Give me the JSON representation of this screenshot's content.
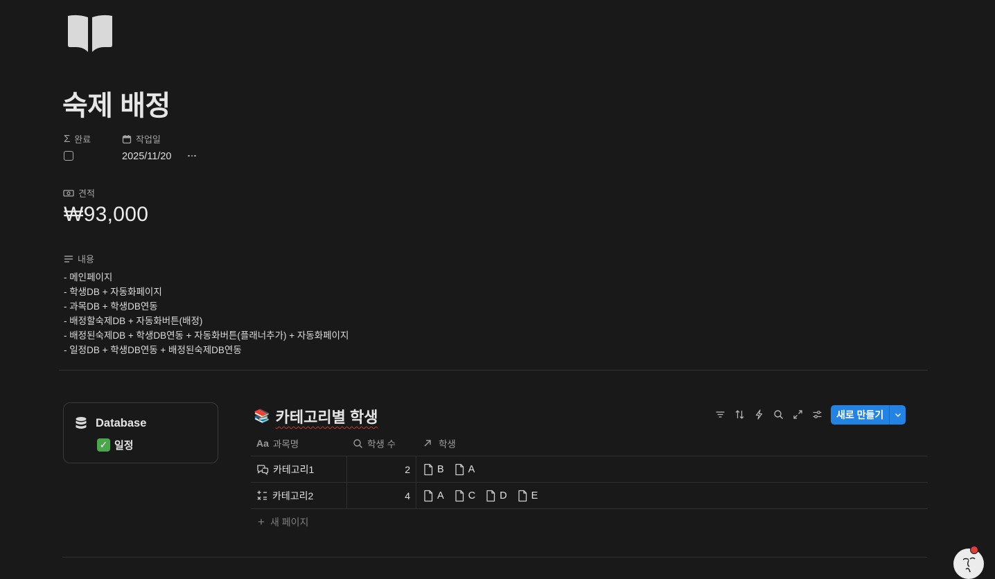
{
  "page": {
    "icon": "book-icon",
    "title": "숙제 배정"
  },
  "properties": {
    "done": {
      "label": "완료",
      "icon": "sigma-icon",
      "checked": false
    },
    "work_date": {
      "label": "작업일",
      "icon": "calendar-icon",
      "value": "2025/11/20"
    },
    "estimate": {
      "label": "견적",
      "icon": "banknote-icon",
      "value": "₩93,000"
    },
    "content": {
      "label": "내용",
      "icon": "text-lines-icon",
      "lines": [
        "- 메인페이지",
        "- 학생DB + 자동화페이지",
        "- 과목DB + 학생DB연동",
        "- 배정할숙제DB + 자동화버튼(배정)",
        "- 배정된숙제DB + 학생DB연동 + 자동화버튼(플래너추가) + 자동화페이지",
        "- 일정DB + 학생DB연동 + 배정된숙제DB연동"
      ]
    }
  },
  "db_card": {
    "title": "Database",
    "icon": "database-icon",
    "link": {
      "emoji": "✓",
      "label": "일정"
    }
  },
  "database": {
    "emoji": "📚",
    "title": "카테고리별 학생",
    "toolbar": {
      "icons": [
        "filter-icon",
        "sort-icon",
        "automation-icon",
        "search-icon",
        "expand-icon",
        "settings-icon"
      ],
      "new_label": "새로 만들기"
    },
    "columns": [
      {
        "label": "과목명",
        "icon": "title-aa-icon"
      },
      {
        "label": "학생 수",
        "icon": "search-icon"
      },
      {
        "label": "학생",
        "icon": "relation-arrow-icon"
      }
    ],
    "rows": [
      {
        "icon": "chat-icon",
        "name": "카테고리1",
        "count": "2",
        "students": [
          "B",
          "A"
        ]
      },
      {
        "icon": "calculator-icon",
        "name": "카테고리2",
        "count": "4",
        "students": [
          "A",
          "C",
          "D",
          "E"
        ]
      }
    ],
    "new_page_label": "새 페이지"
  }
}
